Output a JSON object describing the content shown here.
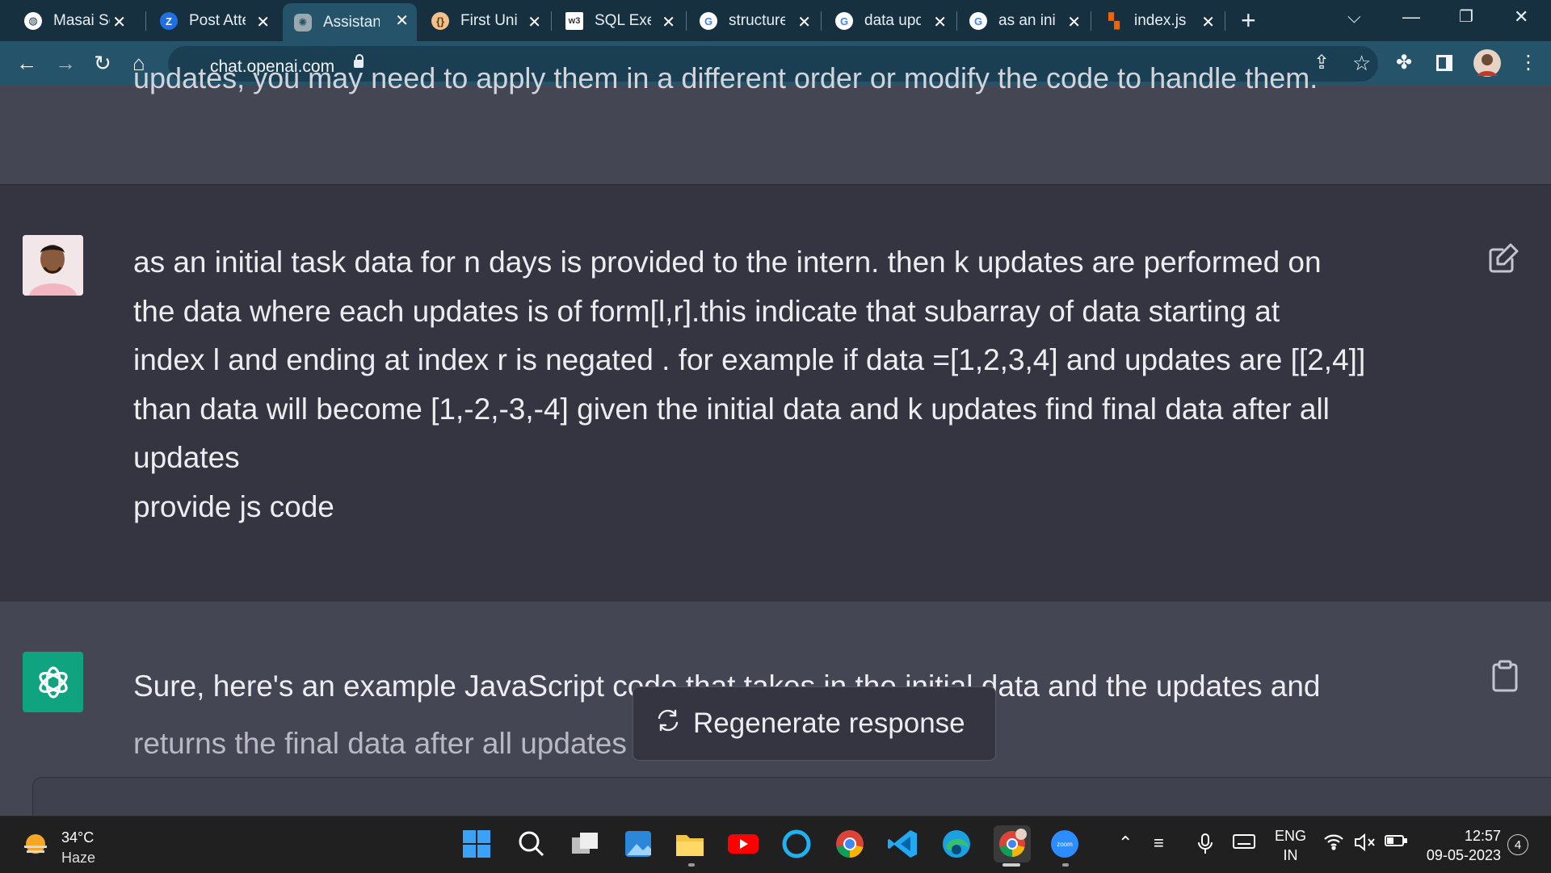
{
  "browser": {
    "tabs": [
      {
        "title": "Masai Sc",
        "icon": "globe-icon",
        "active": false
      },
      {
        "title": "Post Atte",
        "icon": "zoho-icon",
        "active": false
      },
      {
        "title": "Assistanc",
        "icon": "openai-icon",
        "active": true
      },
      {
        "title": "First Uniq",
        "icon": "braces-icon",
        "active": false
      },
      {
        "title": "SQL Exer",
        "icon": "w3schools-icon",
        "active": false
      },
      {
        "title": "structure",
        "icon": "google-icon",
        "active": false
      },
      {
        "title": "data upd",
        "icon": "google-icon",
        "active": false
      },
      {
        "title": "as an init",
        "icon": "google-icon",
        "active": false
      },
      {
        "title": "index.js",
        "icon": "replit-icon",
        "active": false
      }
    ],
    "url": "chat.openai.com"
  },
  "chat": {
    "previous_fragment": "updates, you may need to apply them in a different order or modify the code to handle them.",
    "user_message": [
      "as an initial task data for n days is provided to the intern. then k updates are performed on",
      "the data where each updates is of form[l,r].this indicate that subarray of data starting at",
      "index l and ending at index r is negated . for example if data =[1,2,3,4] and updates are [[2,4]]",
      "than data will become [1,-2,-3,-4] given the initial data and k updates find final data after all",
      "updates",
      "provide js code"
    ],
    "assistant_message": [
      "Sure, here's an example JavaScript code that takes in the initial data and the updates and",
      "returns the final data after all updates"
    ],
    "regenerate_label": "Regenerate response"
  },
  "taskbar": {
    "weather_temp": "34°C",
    "weather_condition": "Haze",
    "lang_line1": "ENG",
    "lang_line2": "IN",
    "time": "12:57",
    "date": "09-05-2023",
    "notification_count": "4"
  },
  "colors": {
    "tab_strip": "#17303f",
    "toolbar": "#25536a",
    "chat_bg": "#343541",
    "chat_alt_bg": "#444654",
    "openai_green": "#10a37f"
  }
}
